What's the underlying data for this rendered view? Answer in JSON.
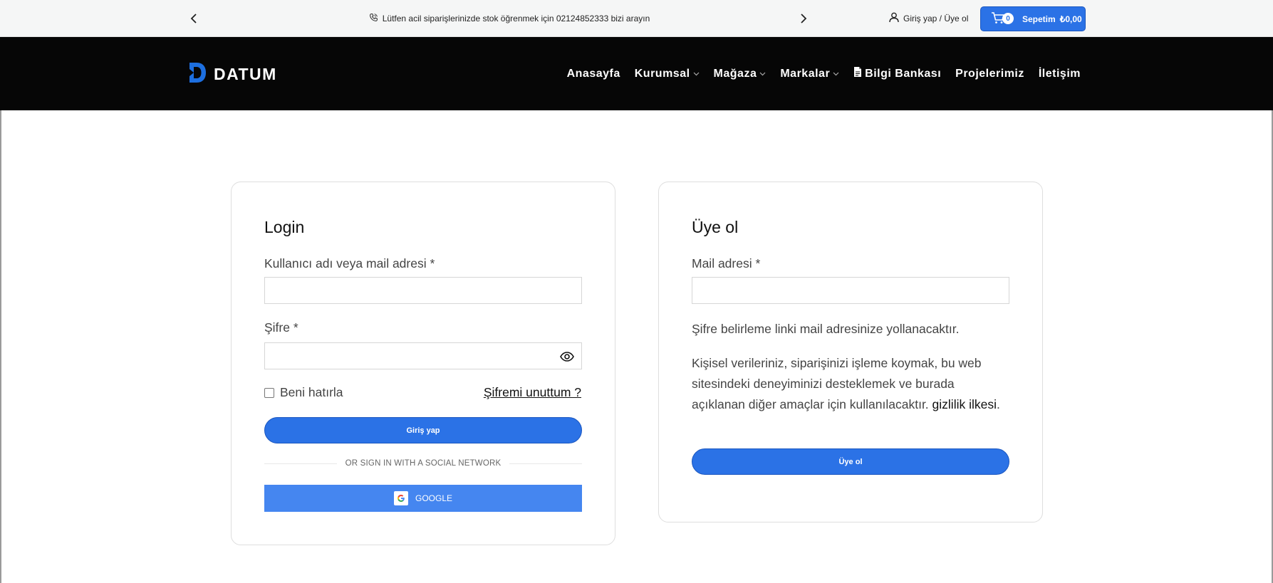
{
  "topbar": {
    "message": "Lütfen acil siparişlerinizde stok öğrenmek için 02124852333 bizi arayın",
    "login_link": "Giriş yap / Üye ol",
    "cart": {
      "count": "0",
      "label": "Sepetim",
      "total": "₺0,00"
    }
  },
  "nav": {
    "logo_text": "DATUM",
    "items": [
      {
        "label": "Anasayfa"
      },
      {
        "label": "Kurumsal"
      },
      {
        "label": "Mağaza"
      },
      {
        "label": "Markalar"
      },
      {
        "label": "Bilgi Bankası"
      },
      {
        "label": "Projelerimiz"
      },
      {
        "label": "İletişim"
      }
    ]
  },
  "login": {
    "title": "Login",
    "username_label": "Kullanıcı adı veya mail adresi *",
    "username_value": "",
    "password_label": "Şifre *",
    "password_value": "",
    "remember_label": "Beni hatırla",
    "remember_checked": false,
    "forgot_label": "Şifremi unuttum ?",
    "submit_label": "Giriş yap",
    "social_divider": "OR SIGN IN WITH A SOCIAL NETWORK",
    "google_label": "GOOGLE"
  },
  "register": {
    "title": "Üye ol",
    "email_label": "Mail adresi *",
    "email_value": "",
    "info_text": "Şifre belirleme linki mail adresinize yollanacaktır.",
    "privacy_text": "Kişisel verileriniz, siparişinizi işleme koymak, bu web sitesindeki deneyiminizi desteklemek ve burada açıklanan diğer amaçlar için kullanılacaktır.",
    "privacy_link": "gizlilik ilkesi",
    "privacy_end": ".",
    "submit_label": "Üye ol"
  },
  "colors": {
    "accent": "#2b72e6",
    "google": "#4586f0",
    "nav_bg": "#060606",
    "topbar_bg": "#f5f6f6"
  },
  "icons": [
    "chevron-left-icon",
    "phone-icon",
    "chevron-right-icon",
    "user-icon",
    "cart-icon",
    "chevron-down-icon",
    "document-icon",
    "eye-icon",
    "google-icon"
  ]
}
